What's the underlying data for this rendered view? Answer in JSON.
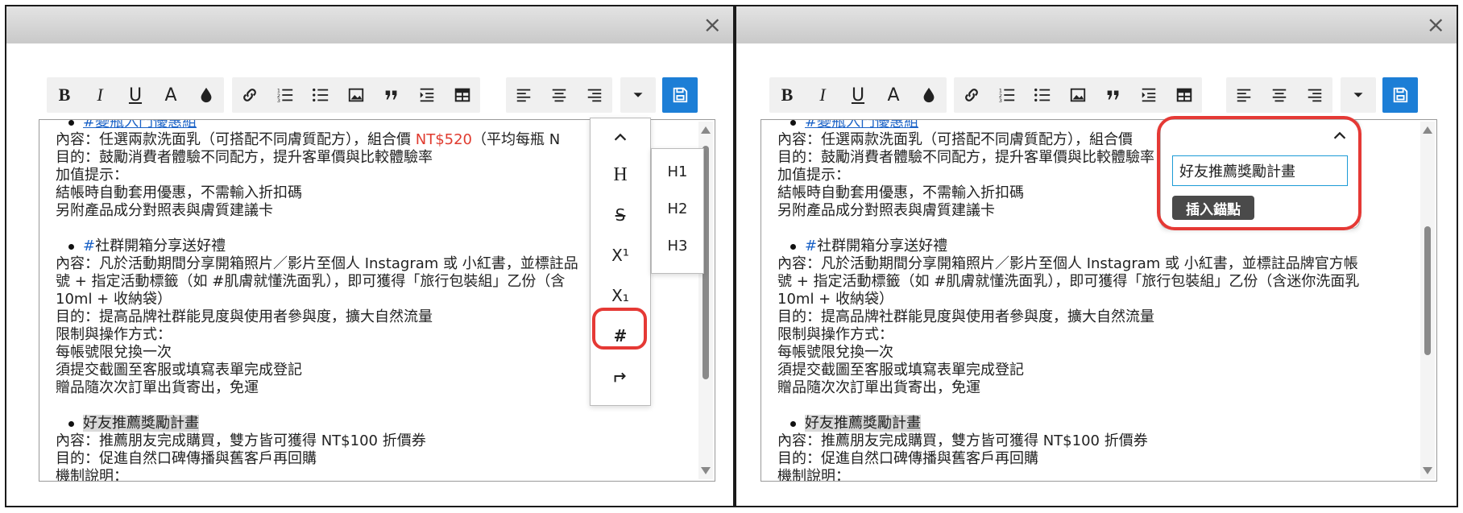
{
  "left_panel": {
    "close_icon": "×",
    "toolbar": {
      "bold": "B",
      "italic": "I",
      "underline": "U",
      "font_size": "A",
      "heading_icon": "H",
      "strike_icon": "S",
      "superscript": "X¹",
      "subscript": "X₁",
      "anchor": "#",
      "redo_icon": "redo-arrow-icon"
    },
    "heading_options": [
      "H1",
      "H2",
      "H3"
    ]
  },
  "right_panel": {
    "close_icon": "×",
    "anchor_popup": {
      "input_value": "好友推薦獎勵計畫",
      "button_label": "插入錨點"
    }
  },
  "content": {
    "top_faded": "#變瓶入門優惠組",
    "line1_a": "內容：任選兩款洗面乳（可搭配不同膚質配方），組合價 ",
    "line1_price": "NT$520",
    "line1_b": "（平均每瓶 N",
    "line1_right_a": "內容：任選兩款洗面乳（可搭配不同膚質配方），組合價",
    "line2": "目的：鼓勵消費者體驗不同配方，提升客單價與比較體驗率",
    "line3": "加值提示：",
    "line4": "結帳時自動套用優惠，不需輸入折扣碼",
    "line5": "另附產品成分對照表與膚質建議卡",
    "bullet2_tag": "#",
    "bullet2_text": "社群開箱分享送好禮",
    "b2_line1_left": "內容：凡於活動期間分享開箱照片／影片至個人 Instagram 或 小紅書，並標註品",
    "b2_line1_right": "內容：凡於活動期間分享開箱照片／影片至個人 Instagram 或 小紅書，並標註品牌官方帳",
    "b2_line2_left": "號 + 指定活動標籤（如 #肌膚就懂洗面乳），即可獲得「旅行包裝組」乙份（含",
    "b2_line2_right": "號 + 指定活動標籤（如 #肌膚就懂洗面乳），即可獲得「旅行包裝組」乙份（含迷你洗面乳",
    "b2_line2_left_tail": "乳",
    "b2_line3": "10ml + 收納袋）",
    "b2_line4": "目的：提高品牌社群能見度與使用者參與度，擴大自然流量",
    "b2_line5": "限制與操作方式：",
    "b2_line6": "每帳號限兌換一次",
    "b2_line7": "須提交截圖至客服或填寫表單完成登記",
    "b2_line8": "贈品隨次次訂單出貨寄出，免運",
    "bullet3_text": "好友推薦獎勵計畫",
    "b3_line1": "內容：推薦朋友完成購買，雙方皆可獲得 NT$100 折價券",
    "b3_line2": "目的：促進自然口碑傳播與舊客戶再回購",
    "b3_line3": "機制說明："
  },
  "colors": {
    "accent_blue": "#1c7ed6",
    "callout_red": "#e53935",
    "price_red": "#e03b2f",
    "tag_blue": "#1c63c7"
  }
}
